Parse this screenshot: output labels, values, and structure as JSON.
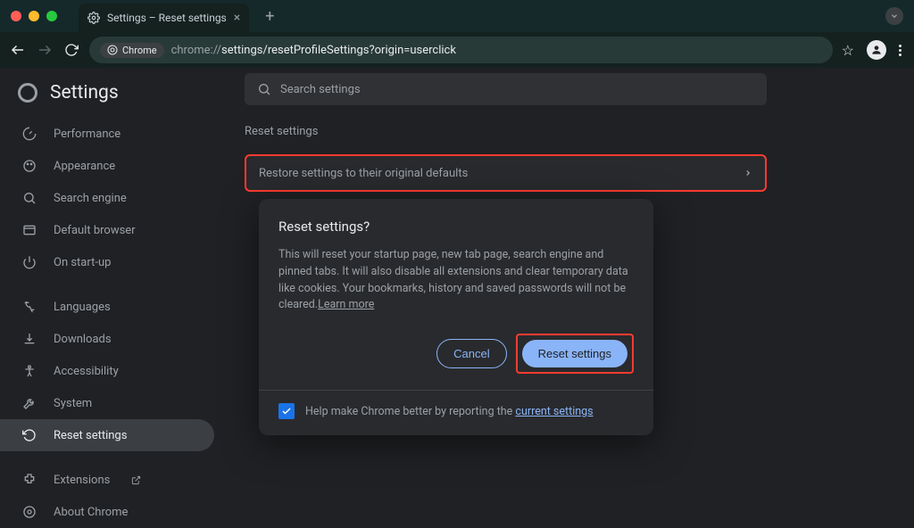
{
  "window": {
    "tab_title": "Settings – Reset settings"
  },
  "toolbar": {
    "chip_label": "Chrome",
    "url_dim": "chrome://",
    "url_path": "settings/resetProfileSettings?origin=userclick"
  },
  "header": {
    "title": "Settings",
    "search_placeholder": "Search settings"
  },
  "sidenav": {
    "items": [
      {
        "label": "Performance"
      },
      {
        "label": "Appearance"
      },
      {
        "label": "Search engine"
      },
      {
        "label": "Default browser"
      },
      {
        "label": "On start-up"
      }
    ],
    "items2": [
      {
        "label": "Languages"
      },
      {
        "label": "Downloads"
      },
      {
        "label": "Accessibility"
      },
      {
        "label": "System"
      },
      {
        "label": "Reset settings"
      }
    ],
    "items3": [
      {
        "label": "Extensions"
      },
      {
        "label": "About Chrome"
      }
    ]
  },
  "main": {
    "section_title": "Reset settings",
    "restore_label": "Restore settings to their original defaults"
  },
  "dialog": {
    "title": "Reset settings?",
    "body": "This will reset your startup page, new tab page, search engine and pinned tabs. It will also disable all extensions and clear temporary data like cookies. Your bookmarks, history and saved passwords will not be cleared.",
    "learn_more": "Learn more",
    "cancel": "Cancel",
    "confirm": "Reset settings",
    "footer_prefix": "Help make Chrome better by reporting the ",
    "footer_link": "current settings"
  }
}
